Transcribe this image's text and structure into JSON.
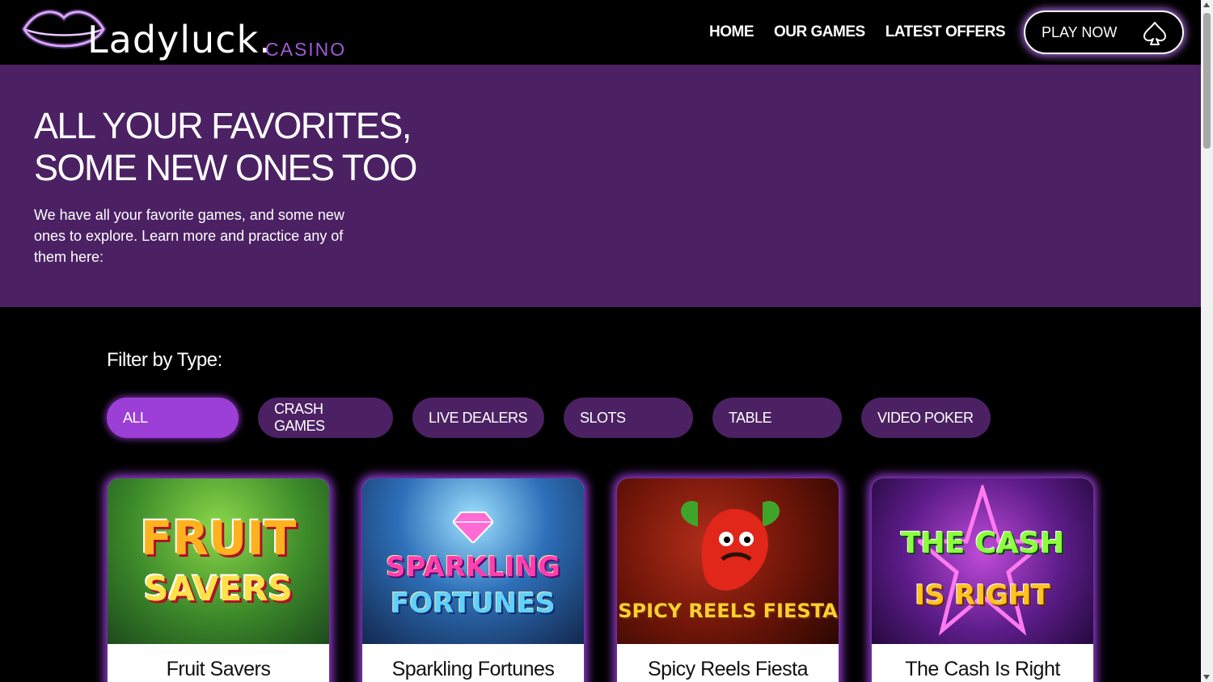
{
  "brand": {
    "name": "Ladyluck.",
    "sub": "CASINO",
    "accent": "#a25ad8",
    "purple_bg": "#4b2163"
  },
  "nav": {
    "items": [
      "HOME",
      "OUR GAMES",
      "LATEST OFFERS"
    ],
    "play_label": "PLAY NOW",
    "play_icon": "spade-icon"
  },
  "hero": {
    "title_line1": "ALL YOUR FAVORITES,",
    "title_line2": "SOME NEW ONES TOO",
    "text": "We have all your favorite games, and some new ones to explore. Learn more and practice any of them here:"
  },
  "filter": {
    "label": "Filter by Type:",
    "options": [
      "ALL",
      "CRASH GAMES",
      "LIVE DEALERS",
      "SLOTS",
      "TABLE",
      "VIDEO POKER"
    ],
    "active": "ALL"
  },
  "games": [
    {
      "title": "Fruit Savers",
      "art_line1": "FRUIT",
      "art_line2": "SAVERS"
    },
    {
      "title": "Sparkling Fortunes",
      "art_line1": "SPARKLING",
      "art_line2": "FORTUNES"
    },
    {
      "title": "Spicy Reels Fiesta",
      "art_line1": "",
      "art_line2": "SPICY REELS FIESTA"
    },
    {
      "title": "The Cash Is Right",
      "art_line1": "THE CASH",
      "art_line2": "IS RIGHT"
    }
  ]
}
